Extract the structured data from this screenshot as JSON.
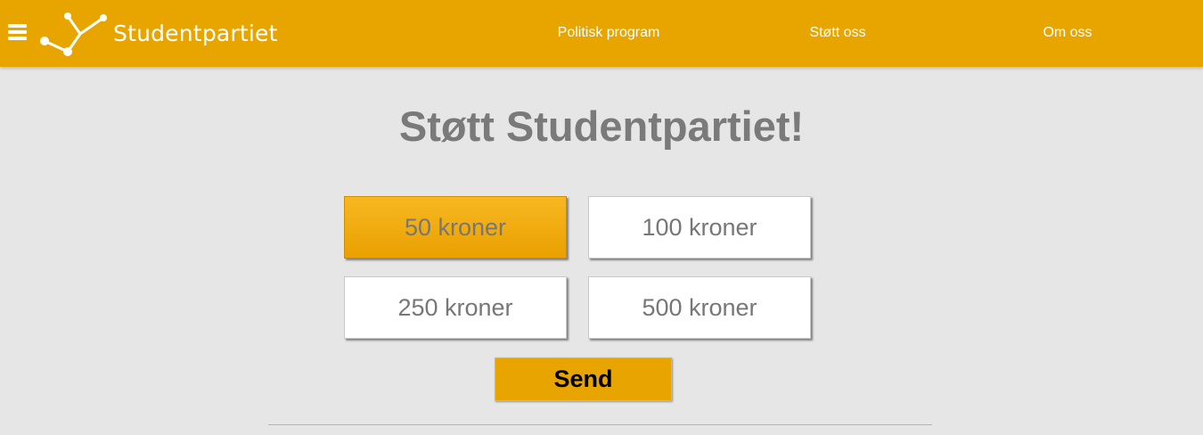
{
  "header": {
    "brand": "Studentpartiet",
    "menu_icon": "hamburger-menu-icon",
    "logo_icon": "constellation-logo-icon",
    "background": "#e8a500",
    "nav": [
      {
        "label": "Politisk program"
      },
      {
        "label": "Støtt oss"
      },
      {
        "label": "Om oss"
      }
    ]
  },
  "main": {
    "title": "Støtt Studentpartiet!",
    "amounts": [
      {
        "label": "50 kroner",
        "selected": true
      },
      {
        "label": "100 kroner",
        "selected": false
      },
      {
        "label": "250 kroner",
        "selected": false
      },
      {
        "label": "500 kroner",
        "selected": false
      }
    ],
    "send_label": "Send",
    "accent_color": "#e8a400"
  }
}
